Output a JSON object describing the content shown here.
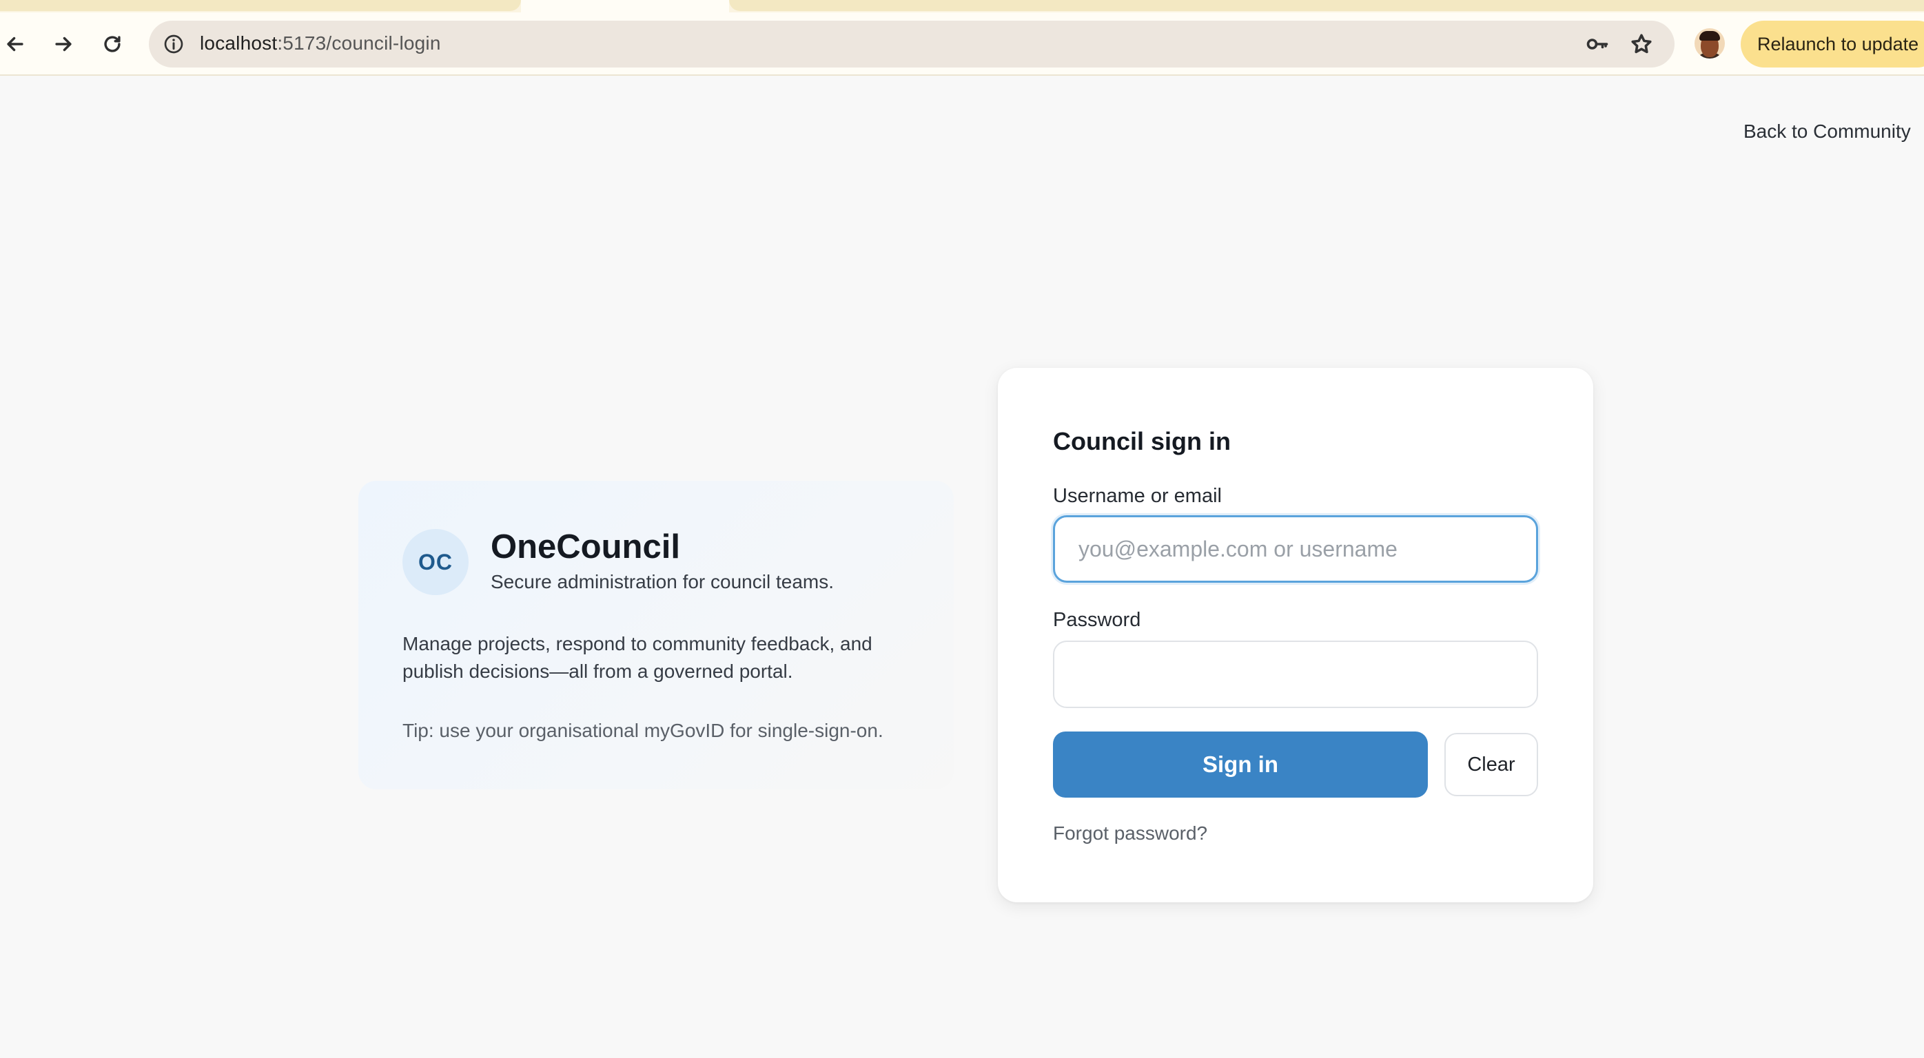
{
  "browser": {
    "url_host": "localhost",
    "url_path": ":5173/council-login",
    "relaunch_label": "Relaunch to update",
    "icons": [
      "back-arrow-icon",
      "forward-arrow-icon",
      "reload-icon",
      "info-icon",
      "key-icon",
      "star-icon"
    ]
  },
  "page": {
    "back_link": "Back to Community"
  },
  "brand": {
    "badge": "OC",
    "title": "OneCouncil",
    "subtitle": "Secure administration for council teams.",
    "description": "Manage projects, respond to community feedback, and publish decisions—all from a governed portal.",
    "tip": "Tip: use your organisational myGovID for single-sign-on."
  },
  "login": {
    "title": "Council sign in",
    "username_label": "Username or email",
    "username_placeholder": "you@example.com or username",
    "username_value": "",
    "password_label": "Password",
    "password_value": "",
    "sign_in_label": "Sign in",
    "clear_label": "Clear",
    "forgot_label": "Forgot password?"
  },
  "colors": {
    "primary": "#3a84c5",
    "focus_ring": "#5aa3dc",
    "relaunch_bg": "#fbe08e",
    "page_bg": "#f8f8f8"
  }
}
